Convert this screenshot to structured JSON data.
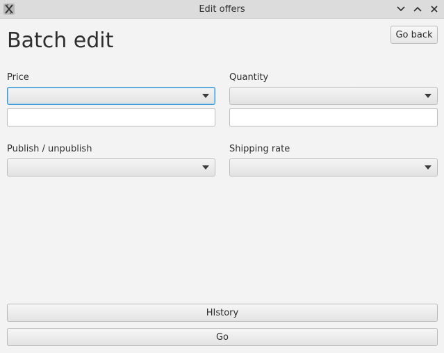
{
  "window": {
    "title": "Edit offers",
    "controls": {
      "minimize_icon": "chevron-down-icon",
      "maximize_icon": "chevron-up-icon",
      "close_icon": "close-icon"
    },
    "app_icon": "x-app-icon"
  },
  "header": {
    "title": "Batch edit",
    "go_back_label": "Go back"
  },
  "fields": {
    "price": {
      "label": "Price",
      "selected": "",
      "value": ""
    },
    "quantity": {
      "label": "Quantity",
      "selected": "",
      "value": ""
    },
    "publish": {
      "label": "Publish / unpublish",
      "selected": ""
    },
    "shipping": {
      "label": "Shipping rate",
      "selected": ""
    }
  },
  "footer": {
    "history_label": "HIstory",
    "go_label": "Go"
  },
  "colors": {
    "focus_accent": "#3b97d3",
    "background": "#f3f3f3",
    "titlebar": "#dcdcdc"
  }
}
